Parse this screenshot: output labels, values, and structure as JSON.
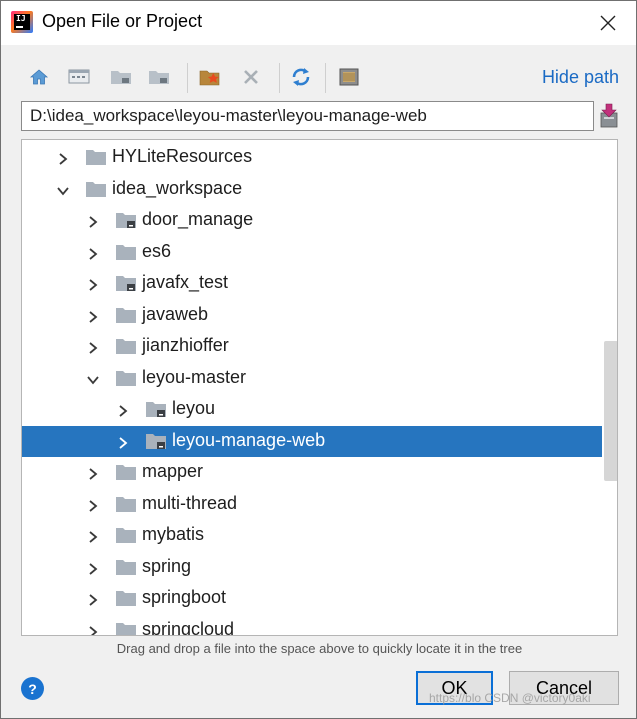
{
  "window": {
    "title": "Open File or Project",
    "icon": "intellij-idea-icon"
  },
  "toolbar": {
    "buttons": [
      {
        "name": "home-icon"
      },
      {
        "name": "desktop-icon"
      },
      {
        "name": "project-folder-icon"
      },
      {
        "name": "module-folder-icon"
      },
      {
        "name": "new-folder-icon"
      },
      {
        "name": "delete-icon"
      },
      {
        "name": "refresh-icon"
      },
      {
        "name": "show-hidden-icon"
      }
    ],
    "hide_path_label": "Hide path"
  },
  "path": {
    "value": "D:\\idea_workspace\\leyou-master\\leyou-manage-web"
  },
  "tree": {
    "rows": [
      {
        "label": "HYLiteResources",
        "depth": 1,
        "expanded": false,
        "marked": false,
        "selected": false
      },
      {
        "label": "idea_workspace",
        "depth": 1,
        "expanded": true,
        "marked": false,
        "selected": false
      },
      {
        "label": "door_manage",
        "depth": 2,
        "expanded": false,
        "marked": true,
        "selected": false
      },
      {
        "label": "es6",
        "depth": 2,
        "expanded": false,
        "marked": false,
        "selected": false
      },
      {
        "label": "javafx_test",
        "depth": 2,
        "expanded": false,
        "marked": true,
        "selected": false
      },
      {
        "label": "javaweb",
        "depth": 2,
        "expanded": false,
        "marked": false,
        "selected": false
      },
      {
        "label": "jianzhioffer",
        "depth": 2,
        "expanded": false,
        "marked": false,
        "selected": false
      },
      {
        "label": "leyou-master",
        "depth": 2,
        "expanded": true,
        "marked": false,
        "selected": false
      },
      {
        "label": "leyou",
        "depth": 3,
        "expanded": false,
        "marked": true,
        "selected": false
      },
      {
        "label": "leyou-manage-web",
        "depth": 3,
        "expanded": false,
        "marked": true,
        "selected": true
      },
      {
        "label": "mapper",
        "depth": 2,
        "expanded": false,
        "marked": false,
        "selected": false
      },
      {
        "label": "multi-thread",
        "depth": 2,
        "expanded": false,
        "marked": false,
        "selected": false
      },
      {
        "label": "mybatis",
        "depth": 2,
        "expanded": false,
        "marked": false,
        "selected": false
      },
      {
        "label": "spring",
        "depth": 2,
        "expanded": false,
        "marked": false,
        "selected": false
      },
      {
        "label": "springboot",
        "depth": 2,
        "expanded": false,
        "marked": false,
        "selected": false
      },
      {
        "label": "springcloud",
        "depth": 2,
        "expanded": false,
        "marked": false,
        "selected": false
      }
    ]
  },
  "hint": "Drag and drop a file into the space above to quickly locate it in the tree",
  "buttons": {
    "help": "?",
    "ok": "OK",
    "cancel": "Cancel"
  },
  "watermark": "https://blo CSDN @victory0aki",
  "colors": {
    "selection": "#2675bf",
    "link": "#1a6ac4",
    "folder": "#a9b2bc",
    "ok_border": "#0a6fd6"
  }
}
